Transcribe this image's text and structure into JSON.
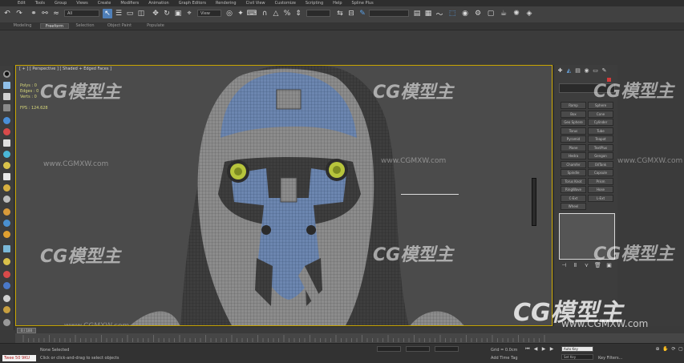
{
  "menu": [
    "Edit",
    "Tools",
    "Group",
    "Views",
    "Create",
    "Modifiers",
    "Animation",
    "Graph Editors",
    "Rendering",
    "Civil View",
    "Customize",
    "Scripting",
    "Help",
    "Spline Plus"
  ],
  "toolbar": {
    "selection_filter": "All",
    "view_dropdown": "View",
    "named_selection": ""
  },
  "ribbon_tabs": [
    "Modeling",
    "Freeform",
    "Selection",
    "Object Paint",
    "Populate"
  ],
  "viewport": {
    "label": "[ + ] [ Perspective ] [ Shaded + Edged Faces ]",
    "stats": {
      "polys_label": "Polys :",
      "polys_value": "0",
      "edges_label": "Edges :",
      "edges_value": "0",
      "verts_label": "Verts :",
      "verts_value": "0",
      "fps_label": "FPS :",
      "fps_value": "124.628"
    }
  },
  "command_panel": {
    "buttons": [
      "Ramp",
      "Sphere",
      "Box",
      "Cone",
      "Geo Sphere",
      "Cylinder",
      "Torus",
      "Tube",
      "Pyramid",
      "Teapot",
      "Plane",
      "TextPlus",
      "Hedra",
      "Gengon",
      "Chamfer",
      "OilTank",
      "Spindle",
      "Capsule",
      "Torus Knot",
      "Prism",
      "RingWave",
      "Hose",
      "C-Ext",
      "L-Ext",
      "Wheel"
    ]
  },
  "timeline": {
    "frame_counter": "0 / 100"
  },
  "status": {
    "maxscript": "Twee 50 9KU",
    "selection": "None Selected",
    "prompt": "Click or click-and-drag to select objects",
    "grid": "Grid = 0.0cm",
    "add_time_tag": "Add Time Tag",
    "auto_key": "Auto Key",
    "set_key": "Set Key",
    "key_filters": "Key Filters..."
  },
  "watermarks": {
    "brand": "CG模型主",
    "url": "www.CGMXW.com"
  }
}
